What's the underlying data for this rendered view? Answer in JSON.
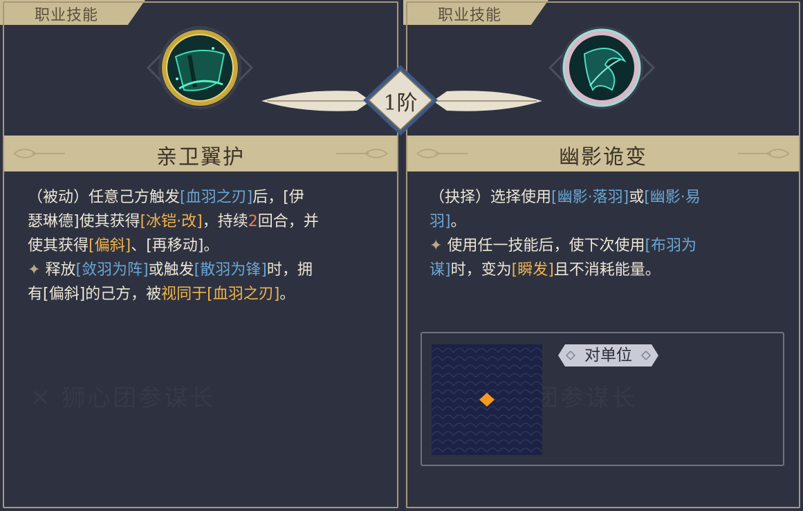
{
  "left_card": {
    "tab_label": "职业技能",
    "skill_name": "亲卫翼护",
    "icon": "shield-wing-icon",
    "description": {
      "line1": [
        "（被动）任意己方触发",
        "[血羽之刃]",
        "后，[伊"
      ],
      "line2": [
        "瑟琳德]使其获得",
        "[冰铠·改]",
        "，持续",
        "2",
        "回合，并"
      ],
      "line3": [
        "使其获得",
        "[偏斜]",
        "、[再移动]。"
      ],
      "line4": [
        "释放",
        "[敛羽为阵]",
        "或触发",
        "[散羽为锋]",
        "时，拥"
      ],
      "line5": [
        "有[偏斜]的己方，被",
        "视同于[血羽之刃]",
        "。"
      ]
    },
    "watermark": "狮心团参谋长"
  },
  "stage_badge": {
    "label": "1阶"
  },
  "right_card": {
    "tab_label": "职业技能",
    "skill_name": "幽影诡变",
    "icon": "shadow-feather-icon",
    "description": {
      "line1": [
        "（抉择）选择使用",
        "[幽影·落羽]",
        "或",
        "[幽影·易"
      ],
      "line2": [
        "羽]",
        "。"
      ],
      "line3": [
        "使用任一技能后，使下次使用",
        "[布羽为"
      ],
      "line4": [
        "谋]",
        "时，变为",
        "[瞬发]",
        "且不消耗能量。"
      ]
    },
    "target_label": "对单位",
    "watermark": "团参谋长"
  },
  "colors": {
    "highlight_blue": "#6aa6d4",
    "highlight_orange": "#f0b44a",
    "number_red": "#ef7f4a",
    "gold_trim": "#cdbf97",
    "panel_bg": "#2e3240"
  }
}
